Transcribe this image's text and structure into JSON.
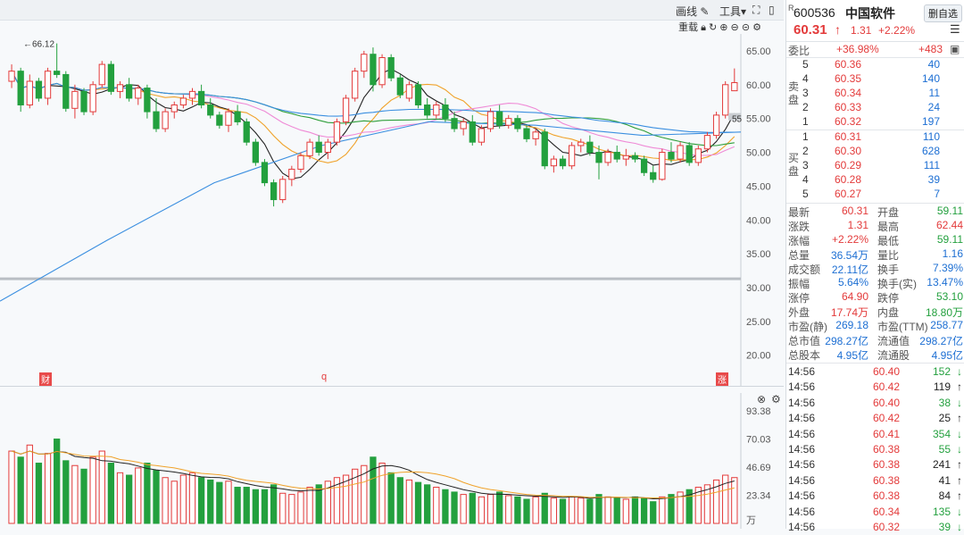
{
  "toolbar": {
    "draw_label": "画线",
    "tools_label": "工具",
    "overlay_label": "重载"
  },
  "chart": {
    "high_marker": "←66.12",
    "price_ticks": [
      "65.00",
      "60.00",
      "55.00",
      "50.00",
      "45.00",
      "40.00",
      "35.00",
      "30.00",
      "25.00",
      "20.00"
    ],
    "volume_ticks": [
      "93.38",
      "70.03",
      "46.69",
      "23.34",
      "万"
    ],
    "event_markers": [
      "财",
      "q",
      "涨"
    ],
    "ma_tag": "55"
  },
  "stock": {
    "code": "600536",
    "code_prefix": "R",
    "name": "中国软件",
    "price": "60.31",
    "change": "1.31",
    "change_pct": "+2.22%",
    "delete_button": "删自选",
    "weibi_label": "委比",
    "weibi_value": "+36.98%",
    "weicha_value": "+483"
  },
  "order_book": {
    "sell_label": "卖盘",
    "buy_label": "买盘",
    "sell": [
      {
        "level": "5",
        "price": "60.36",
        "vol": "40"
      },
      {
        "level": "4",
        "price": "60.35",
        "vol": "140"
      },
      {
        "level": "3",
        "price": "60.34",
        "vol": "11"
      },
      {
        "level": "2",
        "price": "60.33",
        "vol": "24"
      },
      {
        "level": "1",
        "price": "60.32",
        "vol": "197"
      }
    ],
    "buy": [
      {
        "level": "1",
        "price": "60.31",
        "vol": "110"
      },
      {
        "level": "2",
        "price": "60.30",
        "vol": "628"
      },
      {
        "level": "3",
        "price": "60.29",
        "vol": "111"
      },
      {
        "level": "4",
        "price": "60.28",
        "vol": "39"
      },
      {
        "level": "5",
        "price": "60.27",
        "vol": "7"
      }
    ]
  },
  "quote": [
    {
      "l1": "最新",
      "v1": "60.31",
      "c1": "red",
      "l2": "开盘",
      "v2": "59.11",
      "c2": "green"
    },
    {
      "l1": "涨跌",
      "v1": "1.31",
      "c1": "red",
      "l2": "最高",
      "v2": "62.44",
      "c2": "red"
    },
    {
      "l1": "涨幅",
      "v1": "+2.22%",
      "c1": "red",
      "l2": "最低",
      "v2": "59.11",
      "c2": "green"
    },
    {
      "l1": "总量",
      "v1": "36.54万",
      "c1": "blue",
      "l2": "量比",
      "v2": "1.16",
      "c2": "blue"
    },
    {
      "l1": "成交额",
      "v1": "22.11亿",
      "c1": "blue",
      "l2": "换手",
      "v2": "7.39%",
      "c2": "blue"
    },
    {
      "l1": "振幅",
      "v1": "5.64%",
      "c1": "blue",
      "l2": "换手(实)",
      "v2": "13.47%",
      "c2": "blue"
    },
    {
      "l1": "涨停",
      "v1": "64.90",
      "c1": "red",
      "l2": "跌停",
      "v2": "53.10",
      "c2": "green"
    },
    {
      "l1": "外盘",
      "v1": "17.74万",
      "c1": "red",
      "l2": "内盘",
      "v2": "18.80万",
      "c2": "green"
    },
    {
      "l1": "市盈(静)",
      "v1": "269.18",
      "c1": "blue",
      "l2": "市盈(TTM)",
      "v2": "258.77",
      "c2": "blue"
    },
    {
      "l1": "总市值",
      "v1": "298.27亿",
      "c1": "blue",
      "l2": "流通值",
      "v2": "298.27亿",
      "c2": "blue"
    },
    {
      "l1": "总股本",
      "v1": "4.95亿",
      "c1": "blue",
      "l2": "流通股",
      "v2": "4.95亿",
      "c2": "blue"
    }
  ],
  "ticks": [
    {
      "time": "14:56",
      "price": "60.40",
      "vol": "152",
      "dir": "down"
    },
    {
      "time": "14:56",
      "price": "60.42",
      "vol": "119",
      "dir": "up"
    },
    {
      "time": "14:56",
      "price": "60.40",
      "vol": "38",
      "dir": "down"
    },
    {
      "time": "14:56",
      "price": "60.42",
      "vol": "25",
      "dir": "up"
    },
    {
      "time": "14:56",
      "price": "60.41",
      "vol": "354",
      "dir": "down"
    },
    {
      "time": "14:56",
      "price": "60.38",
      "vol": "55",
      "dir": "down"
    },
    {
      "time": "14:56",
      "price": "60.38",
      "vol": "241",
      "dir": "up"
    },
    {
      "time": "14:56",
      "price": "60.38",
      "vol": "41",
      "dir": "up"
    },
    {
      "time": "14:56",
      "price": "60.38",
      "vol": "84",
      "dir": "up"
    },
    {
      "time": "14:56",
      "price": "60.34",
      "vol": "135",
      "dir": "down"
    },
    {
      "time": "14:56",
      "price": "60.32",
      "vol": "39",
      "dir": "down"
    }
  ],
  "colors": {
    "up": "#e33a3a",
    "down": "#23a03e",
    "ma5": "#222222",
    "ma10": "#f0a22a",
    "ma20": "#ef8ad6",
    "ma30": "#2e9e3a",
    "ma60": "#3b8fe0"
  },
  "chart_data": {
    "type": "candlestick",
    "price_axis": [
      20,
      65
    ],
    "candles": [
      [
        60.5,
        63.0,
        59.5,
        62.0
      ],
      [
        62.0,
        62.5,
        56.0,
        57.0
      ],
      [
        57.0,
        61.5,
        56.5,
        60.5
      ],
      [
        60.5,
        61.0,
        57.5,
        58.0
      ],
      [
        58.0,
        62.5,
        57.0,
        62.0
      ],
      [
        62.0,
        66.1,
        61.0,
        61.5
      ],
      [
        61.5,
        62.0,
        56.0,
        56.5
      ],
      [
        56.5,
        60.0,
        55.0,
        59.0
      ],
      [
        59.0,
        59.5,
        55.5,
        56.0
      ],
      [
        56.0,
        60.5,
        55.5,
        60.0
      ],
      [
        60.0,
        63.5,
        59.5,
        63.0
      ],
      [
        63.0,
        63.5,
        58.5,
        59.0
      ],
      [
        59.0,
        60.5,
        58.0,
        60.0
      ],
      [
        60.0,
        61.0,
        57.5,
        58.0
      ],
      [
        58.0,
        60.0,
        57.0,
        59.5
      ],
      [
        59.5,
        60.0,
        55.0,
        56.0
      ],
      [
        56.0,
        58.0,
        53.0,
        53.5
      ],
      [
        53.5,
        56.5,
        53.0,
        56.0
      ],
      [
        56.0,
        57.5,
        55.0,
        57.0
      ],
      [
        57.0,
        58.5,
        56.5,
        58.0
      ],
      [
        58.0,
        59.5,
        57.0,
        59.0
      ],
      [
        59.0,
        60.0,
        56.5,
        57.0
      ],
      [
        57.0,
        58.0,
        55.0,
        55.5
      ],
      [
        55.5,
        56.0,
        53.5,
        54.0
      ],
      [
        54.0,
        56.5,
        53.0,
        56.0
      ],
      [
        56.0,
        57.0,
        54.0,
        54.5
      ],
      [
        54.5,
        55.0,
        51.0,
        51.5
      ],
      [
        51.5,
        52.0,
        48.0,
        48.5
      ],
      [
        48.5,
        49.0,
        45.0,
        45.5
      ],
      [
        45.5,
        46.0,
        42.0,
        43.0
      ],
      [
        43.0,
        46.5,
        42.5,
        46.0
      ],
      [
        46.0,
        48.0,
        45.0,
        47.5
      ],
      [
        47.5,
        50.0,
        47.0,
        49.5
      ],
      [
        49.5,
        52.0,
        49.0,
        51.5
      ],
      [
        51.5,
        52.5,
        49.5,
        50.0
      ],
      [
        50.0,
        52.0,
        49.0,
        51.5
      ],
      [
        51.5,
        55.0,
        51.0,
        54.5
      ],
      [
        54.5,
        58.5,
        54.0,
        58.0
      ],
      [
        58.0,
        62.5,
        57.5,
        62.0
      ],
      [
        62.0,
        65.0,
        61.0,
        64.5
      ],
      [
        64.5,
        65.5,
        59.0,
        60.0
      ],
      [
        60.0,
        64.5,
        59.5,
        64.0
      ],
      [
        64.0,
        64.5,
        60.5,
        61.0
      ],
      [
        61.0,
        61.5,
        58.0,
        58.5
      ],
      [
        58.0,
        60.5,
        57.5,
        60.0
      ],
      [
        60.0,
        60.5,
        56.5,
        57.0
      ],
      [
        57.0,
        58.0,
        55.0,
        55.5
      ],
      [
        55.5,
        57.5,
        55.0,
        57.0
      ],
      [
        57.0,
        58.0,
        54.5,
        55.0
      ],
      [
        55.0,
        56.0,
        53.0,
        53.5
      ],
      [
        53.5,
        55.0,
        52.5,
        54.5
      ],
      [
        54.5,
        55.5,
        51.0,
        51.5
      ],
      [
        51.5,
        54.0,
        51.0,
        53.5
      ],
      [
        53.5,
        56.5,
        53.0,
        56.0
      ],
      [
        56.0,
        57.0,
        53.5,
        54.0
      ],
      [
        54.0,
        55.5,
        53.5,
        55.0
      ],
      [
        55.0,
        55.5,
        53.0,
        53.5
      ],
      [
        53.5,
        54.0,
        51.5,
        52.0
      ],
      [
        52.0,
        53.5,
        51.0,
        53.0
      ],
      [
        53.0,
        53.5,
        47.5,
        48.0
      ],
      [
        48.0,
        49.5,
        47.0,
        49.0
      ],
      [
        49.0,
        49.5,
        47.5,
        48.0
      ],
      [
        48.0,
        51.5,
        47.5,
        51.0
      ],
      [
        51.0,
        52.0,
        50.0,
        51.5
      ],
      [
        51.5,
        52.5,
        49.5,
        50.0
      ],
      [
        50.0,
        51.0,
        46.0,
        48.5
      ],
      [
        48.5,
        50.5,
        48.0,
        50.0
      ],
      [
        50.0,
        51.0,
        48.5,
        49.0
      ],
      [
        49.0,
        50.5,
        48.0,
        49.5
      ],
      [
        49.5,
        50.0,
        48.5,
        49.0
      ],
      [
        49.0,
        49.5,
        46.5,
        47.0
      ],
      [
        47.0,
        48.0,
        45.5,
        46.0
      ],
      [
        46.0,
        50.5,
        45.8,
        50.0
      ],
      [
        50.0,
        51.5,
        48.5,
        49.0
      ],
      [
        49.0,
        51.5,
        48.5,
        51.0
      ],
      [
        51.0,
        51.5,
        48.0,
        48.5
      ],
      [
        48.5,
        51.0,
        48.0,
        50.5
      ],
      [
        50.5,
        53.0,
        50.0,
        52.5
      ],
      [
        52.5,
        56.0,
        52.0,
        55.5
      ],
      [
        55.5,
        60.5,
        55.0,
        60.0
      ],
      [
        59.1,
        62.4,
        59.1,
        60.3
      ]
    ],
    "volumes": [
      60,
      55,
      65,
      50,
      58,
      70,
      52,
      48,
      45,
      55,
      60,
      50,
      42,
      40,
      46,
      50,
      44,
      38,
      35,
      40,
      42,
      38,
      36,
      34,
      35,
      30,
      30,
      28,
      28,
      32,
      25,
      24,
      26,
      30,
      32,
      35,
      38,
      40,
      45,
      48,
      55,
      50,
      42,
      38,
      36,
      34,
      32,
      30,
      28,
      26,
      24,
      25,
      22,
      24,
      26,
      23,
      22,
      20,
      22,
      25,
      21,
      20,
      22,
      21,
      20,
      24,
      22,
      21,
      20,
      22,
      21,
      18,
      22,
      24,
      26,
      28,
      30,
      32,
      36,
      40,
      38
    ],
    "volume_axis": [
      0,
      93.38
    ]
  }
}
